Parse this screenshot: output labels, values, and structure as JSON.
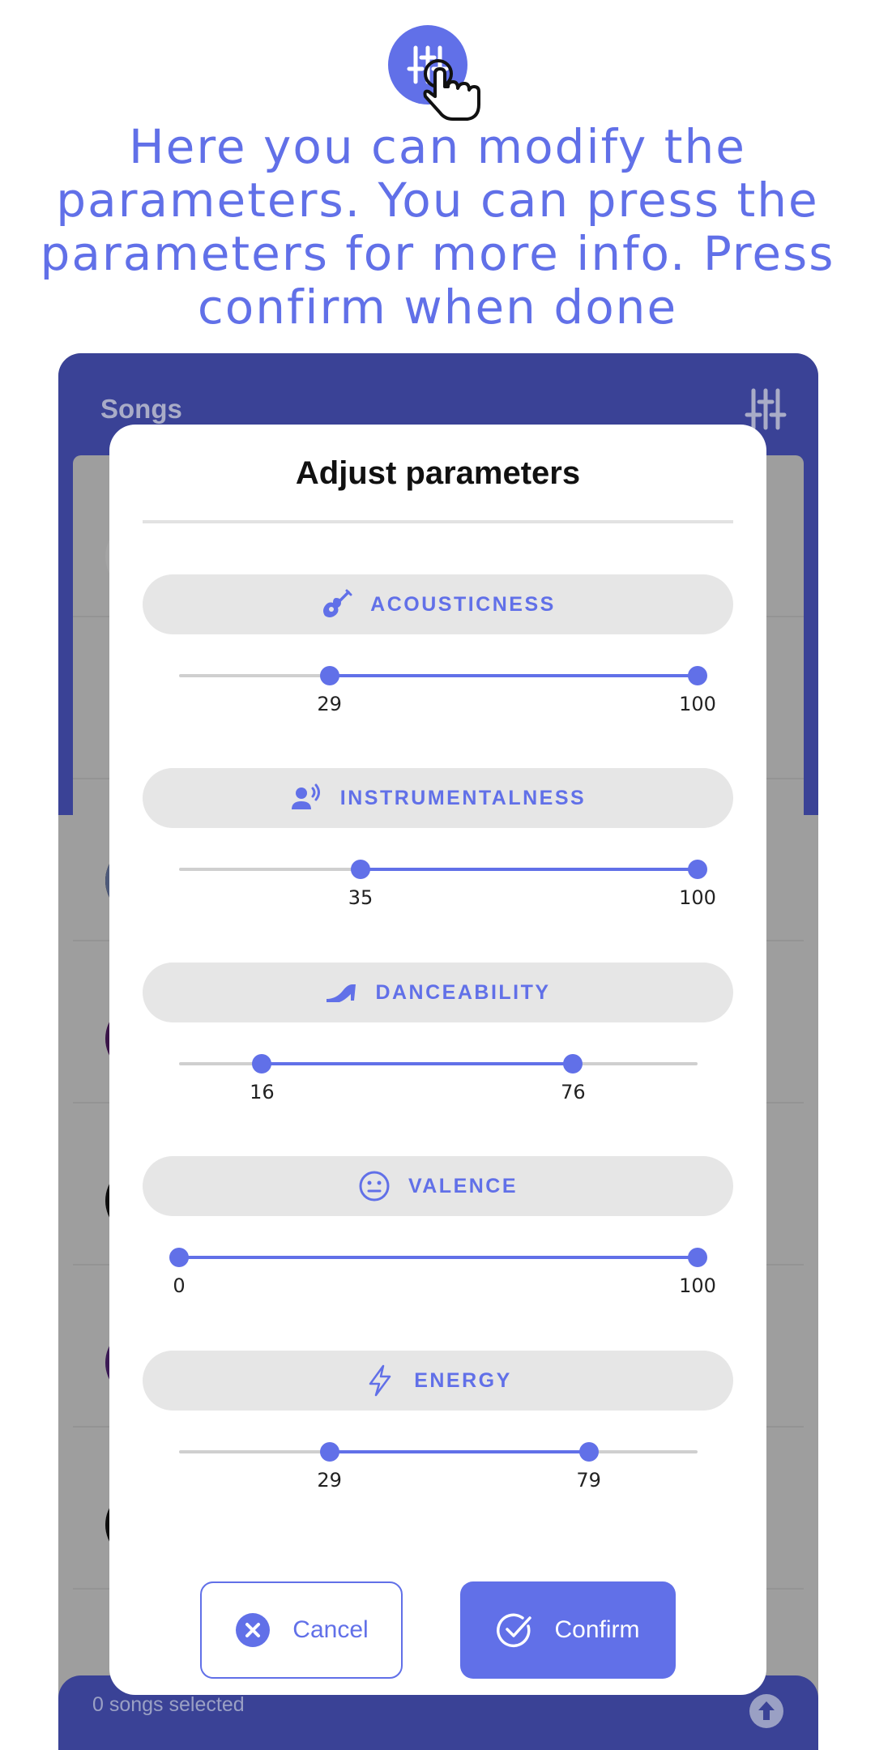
{
  "tutorial": {
    "message": "Here you can modify the parameters. You can press the parameters for more info. Press confirm when done",
    "icon": "sliders-tap-icon"
  },
  "app": {
    "title": "Songs",
    "filter_icon": "sliders-icon",
    "selected_text": "0 songs selected",
    "upload_icon": "arrow-up-circle-icon"
  },
  "dialog": {
    "title": "Adjust parameters",
    "parameters": [
      {
        "label": "ACOUSTICNESS",
        "icon": "guitar-icon",
        "min": 29,
        "max": 100,
        "min_label": "29",
        "max_label": "100"
      },
      {
        "label": "INSTRUMENTALNESS",
        "icon": "person-voice-icon",
        "min": 35,
        "max": 100,
        "min_label": "35",
        "max_label": "100"
      },
      {
        "label": "DANCEABILITY",
        "icon": "high-heel-icon",
        "min": 16,
        "max": 76,
        "min_label": "16",
        "max_label": "76"
      },
      {
        "label": "VALENCE",
        "icon": "neutral-face-icon",
        "min": 0,
        "max": 100,
        "min_label": "0",
        "max_label": "100"
      },
      {
        "label": "ENERGY",
        "icon": "lightning-icon",
        "min": 29,
        "max": 79,
        "min_label": "29",
        "max_label": "79"
      }
    ],
    "cancel_label": "Cancel",
    "confirm_label": "Confirm"
  },
  "colors": {
    "accent": "#6170e8",
    "appbar": "#3a4296",
    "scrim": "#9e9e9e"
  }
}
